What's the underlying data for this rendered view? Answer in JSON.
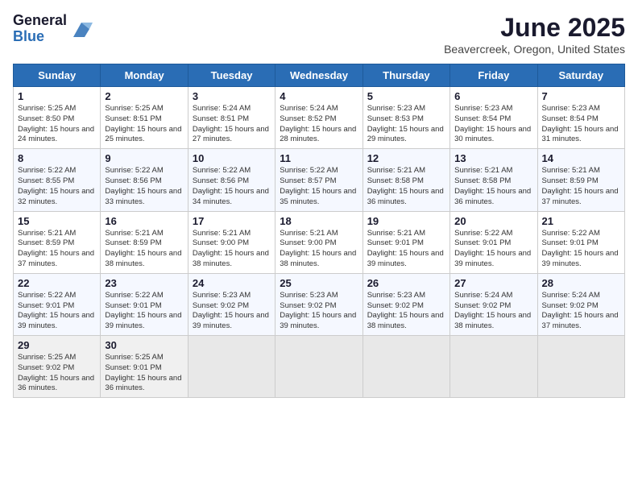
{
  "header": {
    "logo_general": "General",
    "logo_blue": "Blue",
    "title": "June 2025",
    "location": "Beavercreek, Oregon, United States"
  },
  "weekdays": [
    "Sunday",
    "Monday",
    "Tuesday",
    "Wednesday",
    "Thursday",
    "Friday",
    "Saturday"
  ],
  "weeks": [
    [
      {
        "day": "1",
        "sunrise": "5:25 AM",
        "sunset": "8:50 PM",
        "daylight": "15 hours and 24 minutes."
      },
      {
        "day": "2",
        "sunrise": "5:25 AM",
        "sunset": "8:51 PM",
        "daylight": "15 hours and 25 minutes."
      },
      {
        "day": "3",
        "sunrise": "5:24 AM",
        "sunset": "8:51 PM",
        "daylight": "15 hours and 27 minutes."
      },
      {
        "day": "4",
        "sunrise": "5:24 AM",
        "sunset": "8:52 PM",
        "daylight": "15 hours and 28 minutes."
      },
      {
        "day": "5",
        "sunrise": "5:23 AM",
        "sunset": "8:53 PM",
        "daylight": "15 hours and 29 minutes."
      },
      {
        "day": "6",
        "sunrise": "5:23 AM",
        "sunset": "8:54 PM",
        "daylight": "15 hours and 30 minutes."
      },
      {
        "day": "7",
        "sunrise": "5:23 AM",
        "sunset": "8:54 PM",
        "daylight": "15 hours and 31 minutes."
      }
    ],
    [
      {
        "day": "8",
        "sunrise": "5:22 AM",
        "sunset": "8:55 PM",
        "daylight": "15 hours and 32 minutes."
      },
      {
        "day": "9",
        "sunrise": "5:22 AM",
        "sunset": "8:56 PM",
        "daylight": "15 hours and 33 minutes."
      },
      {
        "day": "10",
        "sunrise": "5:22 AM",
        "sunset": "8:56 PM",
        "daylight": "15 hours and 34 minutes."
      },
      {
        "day": "11",
        "sunrise": "5:22 AM",
        "sunset": "8:57 PM",
        "daylight": "15 hours and 35 minutes."
      },
      {
        "day": "12",
        "sunrise": "5:21 AM",
        "sunset": "8:58 PM",
        "daylight": "15 hours and 36 minutes."
      },
      {
        "day": "13",
        "sunrise": "5:21 AM",
        "sunset": "8:58 PM",
        "daylight": "15 hours and 36 minutes."
      },
      {
        "day": "14",
        "sunrise": "5:21 AM",
        "sunset": "8:59 PM",
        "daylight": "15 hours and 37 minutes."
      }
    ],
    [
      {
        "day": "15",
        "sunrise": "5:21 AM",
        "sunset": "8:59 PM",
        "daylight": "15 hours and 37 minutes."
      },
      {
        "day": "16",
        "sunrise": "5:21 AM",
        "sunset": "8:59 PM",
        "daylight": "15 hours and 38 minutes."
      },
      {
        "day": "17",
        "sunrise": "5:21 AM",
        "sunset": "9:00 PM",
        "daylight": "15 hours and 38 minutes."
      },
      {
        "day": "18",
        "sunrise": "5:21 AM",
        "sunset": "9:00 PM",
        "daylight": "15 hours and 38 minutes."
      },
      {
        "day": "19",
        "sunrise": "5:21 AM",
        "sunset": "9:01 PM",
        "daylight": "15 hours and 39 minutes."
      },
      {
        "day": "20",
        "sunrise": "5:22 AM",
        "sunset": "9:01 PM",
        "daylight": "15 hours and 39 minutes."
      },
      {
        "day": "21",
        "sunrise": "5:22 AM",
        "sunset": "9:01 PM",
        "daylight": "15 hours and 39 minutes."
      }
    ],
    [
      {
        "day": "22",
        "sunrise": "5:22 AM",
        "sunset": "9:01 PM",
        "daylight": "15 hours and 39 minutes."
      },
      {
        "day": "23",
        "sunrise": "5:22 AM",
        "sunset": "9:01 PM",
        "daylight": "15 hours and 39 minutes."
      },
      {
        "day": "24",
        "sunrise": "5:23 AM",
        "sunset": "9:02 PM",
        "daylight": "15 hours and 39 minutes."
      },
      {
        "day": "25",
        "sunrise": "5:23 AM",
        "sunset": "9:02 PM",
        "daylight": "15 hours and 39 minutes."
      },
      {
        "day": "26",
        "sunrise": "5:23 AM",
        "sunset": "9:02 PM",
        "daylight": "15 hours and 38 minutes."
      },
      {
        "day": "27",
        "sunrise": "5:24 AM",
        "sunset": "9:02 PM",
        "daylight": "15 hours and 38 minutes."
      },
      {
        "day": "28",
        "sunrise": "5:24 AM",
        "sunset": "9:02 PM",
        "daylight": "15 hours and 37 minutes."
      }
    ],
    [
      {
        "day": "29",
        "sunrise": "5:25 AM",
        "sunset": "9:02 PM",
        "daylight": "15 hours and 36 minutes."
      },
      {
        "day": "30",
        "sunrise": "5:25 AM",
        "sunset": "9:01 PM",
        "daylight": "15 hours and 36 minutes."
      },
      null,
      null,
      null,
      null,
      null
    ]
  ]
}
